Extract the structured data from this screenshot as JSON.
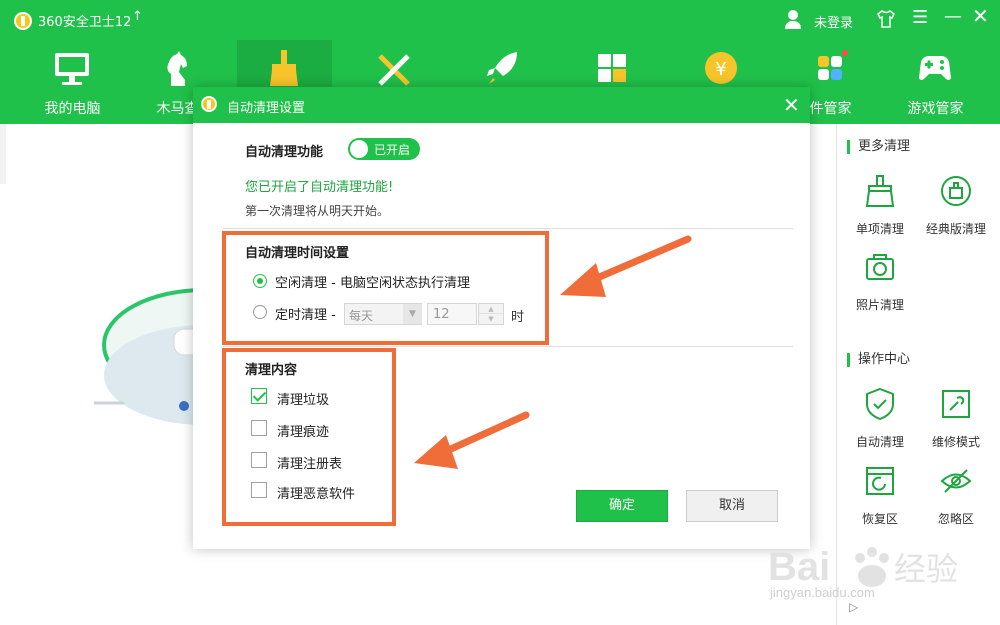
{
  "app": {
    "title": "360安全卫士12",
    "upgrade_icon": "↑",
    "login_label": "未登录",
    "menu_glyph": "☰",
    "minimize_glyph": "—",
    "close_glyph": "✕",
    "accent_color": "#20c14a"
  },
  "nav": {
    "items": [
      {
        "label": "我的电脑",
        "icon": "computer-icon"
      },
      {
        "label": "木马查",
        "icon": "trojan-horse-icon"
      },
      {
        "label": "",
        "icon": "broom-icon"
      },
      {
        "label": "",
        "icon": "tools-icon"
      },
      {
        "label": "",
        "icon": "rocket-icon"
      },
      {
        "label": "",
        "icon": "apps-icon"
      },
      {
        "label": "",
        "icon": "coin-icon"
      },
      {
        "label": "件管家",
        "icon": "software-manager-icon"
      },
      {
        "label": "游戏管家",
        "icon": "gamepad-icon"
      }
    ]
  },
  "right_panel": {
    "more_clean_heading": "更多清理",
    "more_clean_items": [
      {
        "label": "单项清理",
        "icon": "broom-icon"
      },
      {
        "label": "经典版清理",
        "icon": "classic-clean-icon"
      },
      {
        "label": "照片清理",
        "icon": "camera-icon"
      }
    ],
    "ops_heading": "操作中心",
    "ops_items": [
      {
        "label": "自动清理",
        "icon": "shield-check-icon"
      },
      {
        "label": "维修模式",
        "icon": "wrench-icon"
      },
      {
        "label": "恢复区",
        "icon": "restore-icon"
      },
      {
        "label": "忽略区",
        "icon": "ignore-eye-icon"
      }
    ],
    "expand_glyph": "▷"
  },
  "dialog": {
    "title": "自动清理设置",
    "close_glyph": "✕",
    "auto_clean_label": "自动清理功能",
    "toggle_state": "已开启",
    "enabled_message": "您已开启了自动清理功能!",
    "first_clean_message": "第一次清理将从明天开始。",
    "time_settings_label": "自动清理时间设置",
    "radio_idle_label": "空闲清理 - 电脑空闲状态执行清理",
    "radio_idle_checked": true,
    "radio_timed_label": "定时清理 -",
    "frequency_value": "每天",
    "hour_value": "12",
    "hour_unit": "时",
    "content_label": "清理内容",
    "checkboxes": [
      {
        "label": "清理垃圾",
        "checked": true
      },
      {
        "label": "清理痕迹",
        "checked": false
      },
      {
        "label": "清理注册表",
        "checked": false
      },
      {
        "label": "清理恶意软件",
        "checked": false
      }
    ],
    "ok_label": "确定",
    "cancel_label": "取消"
  },
  "annotation_color": "#f06d3a",
  "watermark": {
    "text": "Bai经验",
    "sub": "jingyan.baidu.com"
  }
}
